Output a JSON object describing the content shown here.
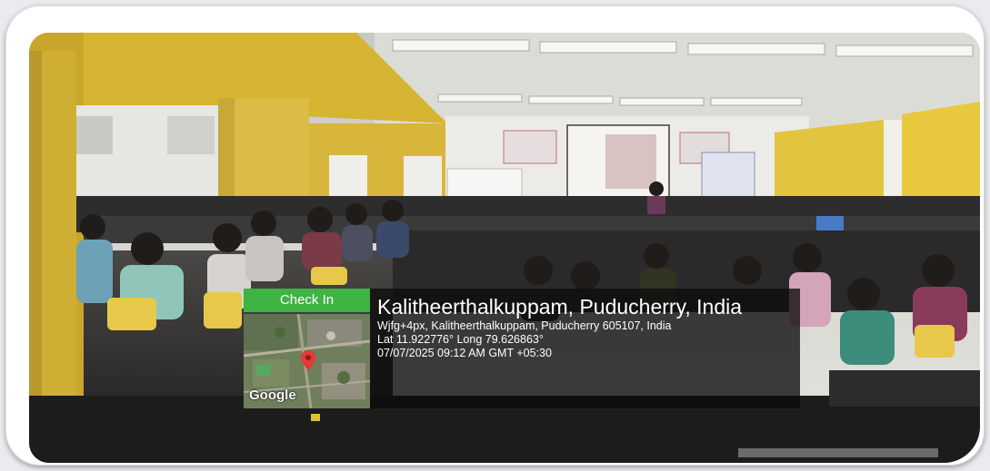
{
  "geotag": {
    "checkin_label": "Check In",
    "place_name": "Kalitheerthalkuppam, Puducherry, India",
    "address": "Wjfg+4px, Kalitheerthalkuppam, Puducherry 605107, India",
    "coordinates": "Lat 11.922776° Long 79.626863°",
    "datetime": "07/07/2025 09:12 AM GMT +05:30",
    "map_brand": "Google",
    "map_pin_icon": "map-pin-icon",
    "accent_color": "#3fb344",
    "pin_color": "#e53935"
  }
}
